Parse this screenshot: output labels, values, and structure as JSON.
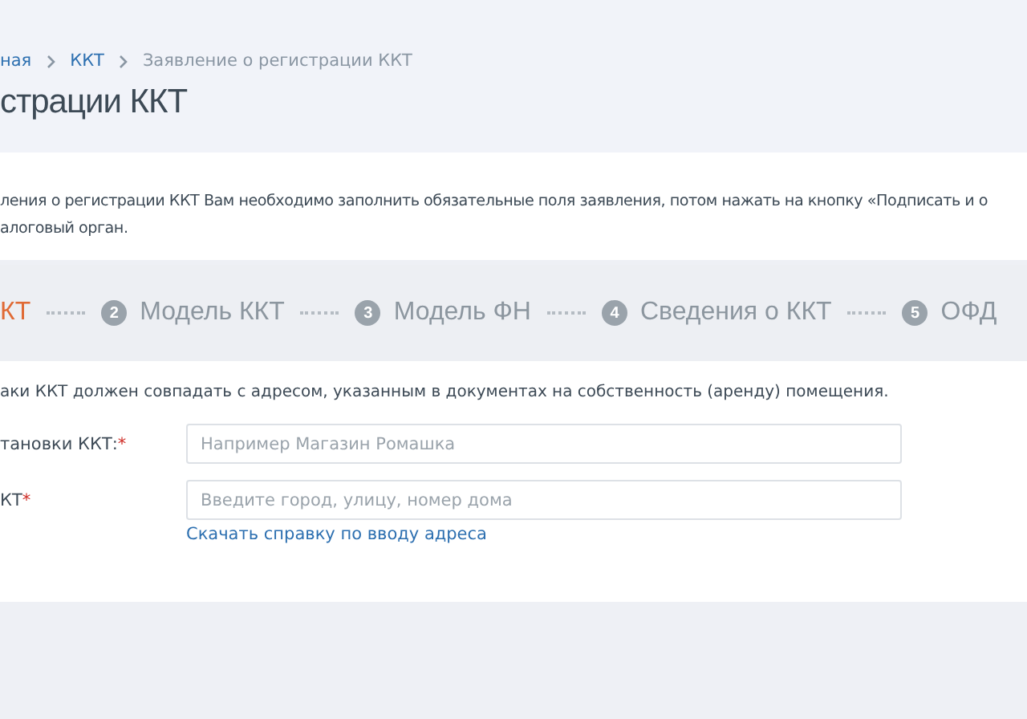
{
  "breadcrumbs": [
    {
      "label": "ная",
      "kind": "link"
    },
    {
      "label": "ККТ",
      "kind": "link"
    },
    {
      "label": "Заявление о регистрации ККТ",
      "kind": "current"
    }
  ],
  "title": "страции ККТ",
  "intro": [
    "ления о регистрации ККТ Вам необходимо заполнить обязательные поля заявления, потом нажать на кнопку «Подписать и о",
    "алоговый орган."
  ],
  "steps": [
    {
      "label": "КТ",
      "selected": true
    },
    {
      "number": "2",
      "label": "Модель ККТ",
      "selected": false
    },
    {
      "number": "3",
      "label": "Модель ФН",
      "selected": false
    },
    {
      "number": "4",
      "label": "Сведения о ККТ",
      "selected": false
    },
    {
      "number": "5",
      "label": "ОФД",
      "selected": false
    }
  ],
  "note": "аки ККТ должен совпадать с адресом, указанным в документах на собственность (аренду) помещения.",
  "fields": [
    {
      "label": "тановки ККТ:",
      "marker": "*",
      "placeholder": "Например Магазин Ромашка"
    },
    {
      "label": "КТ",
      "marker": "*",
      "placeholder": "Введите город, улицу, номер дома",
      "link": "Скачать справку по вводу адреса"
    }
  ]
}
